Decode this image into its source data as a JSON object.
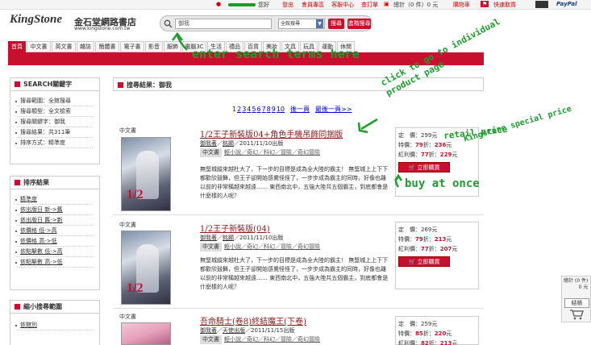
{
  "topbar": {
    "greeting": "您好",
    "login": "登出",
    "member_services": "會員專區",
    "customer_service": "客服中心",
    "orders": "查訂單",
    "cart_summary": "總計（0 件）0 元",
    "cart_label": "購物車",
    "fast_pickup": "快速取貨",
    "paypal": "PayPal"
  },
  "logo": {
    "brand": "KingStone",
    "name_cn": "金石堂網路書店",
    "url": "www.kingstone.com.tw"
  },
  "search": {
    "value": "御我",
    "category": "全館搜尋",
    "search_btn": "搜尋",
    "advanced_btn": "進階搜尋"
  },
  "nav": {
    "tabs": [
      "首頁",
      "中文書",
      "英文書",
      "雜誌",
      "簡體書",
      "電子書",
      "影音",
      "服飾",
      "電腦3C",
      "生活",
      "禮品",
      "百貨",
      "美妝",
      "文具",
      "玩具",
      "運動",
      "休閒"
    ]
  },
  "sidebar": {
    "keyword_box": {
      "title": "SEARCH關鍵字",
      "items": [
        "搜尋範圍：全館搜尋",
        "搜尋類型：全文檢索",
        "搜尋關鍵字：御我",
        "搜尋結果：共311筆",
        "排序方式：精準度"
      ]
    },
    "sort_box": {
      "title": "排序結果",
      "items": [
        "精準度",
        "依出版日 新->舊",
        "依出版日 舊->新",
        "依價格 低->高",
        "依價格 高->低",
        "依點擊數 低->高",
        "依點擊數 高->低"
      ]
    },
    "narrow_box": {
      "title": "縮小搜尋範圍",
      "items": [
        "依館別"
      ]
    }
  },
  "results": {
    "header": "搜尋結果：御我",
    "pager": {
      "pages": [
        "1",
        "2",
        "3",
        "4",
        "5",
        "6",
        "7",
        "8",
        "9",
        "10"
      ],
      "next": "後一頁",
      "last": "最後一頁>>"
    },
    "products": [
      {
        "category": "中文書",
        "title": "1/2王子新裝版04+角色手機吊飾同捆版",
        "author": "御我著",
        "publisher": "銘顯",
        "date": "2011/11/10出版",
        "tags_label": "中文書",
        "tags": "輕小說／奇幻／科幻／冒險／奇幻冒險",
        "desc": "無堅城縱來越杜大了，下一步的目標是成為全大陸的霸主！ 無堅城上上下下都歡欣鼓舞，但王子卻開始感覺怪怪了，一步步成為霸主的同時，好像也離以前的非常稱越來越遠…… 東西南北中，五強大陸共五個霸主，到底都會是什麼樣的人呢？",
        "list_price": "定　價：299元",
        "discount": "79",
        "special_price": "236",
        "bonus_discount": "77",
        "bonus_price": "229",
        "buy": "立即購買"
      },
      {
        "category": "中文書",
        "title": "1/2王子新裝版(04)",
        "author": "御我著",
        "publisher": "銘顯",
        "date": "2011/11/10出版",
        "tags_label": "中文書",
        "tags": "輕小說／奇幻／科幻／冒險／奇幻冒險",
        "desc": "無堅城縱來越杜大了，下一步的目標是成為全大陸的霸主！ 無堅城上上下下都歡欣鼓舞，但王子卻開始感覺怪怪了，一步步成為霸主的同時，好像也離以前的非常稱越來越遠…… 東西南北中，五強大陸共五個霸主，到底都會是什麼樣的人呢？",
        "list_price": "定　價：269元",
        "discount": "79",
        "special_price": "213",
        "bonus_discount": "77",
        "bonus_price": "207",
        "buy": "立即購買"
      },
      {
        "category": "中文書",
        "title": "吾命騎士(卷8)終結魔王(下卷)",
        "author": "御我著",
        "publisher": "天使出版",
        "date": "2011/11/15出版",
        "tags_label": "中文書",
        "tags": "輕小說／奇幻／科幻／冒險／奇幻冒險",
        "list_price": "定　價：259元",
        "discount": "85",
        "special_price": "220",
        "bonus_discount": "82",
        "bonus_price": "213"
      }
    ]
  },
  "price_labels": {
    "special": "特價：",
    "bonus": "紅利價：",
    "off": "折：",
    "yuan": "元"
  },
  "cart_widget": {
    "line1": "總計 (0 件)",
    "line2": "0 元",
    "checkout": "結帳"
  },
  "annotations": {
    "search": "enter search terms here",
    "product_page": "click to go to individual product page",
    "retail": "retail price",
    "special": "Kingstone special price",
    "buy": "buy at once"
  }
}
